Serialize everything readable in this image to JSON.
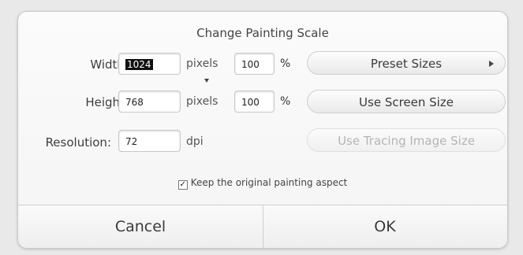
{
  "dialog": {
    "title": "Change Painting Scale",
    "width": {
      "label": "Width:",
      "value": "1024",
      "unit": "pixels",
      "percent": "100",
      "percent_sign": "%"
    },
    "height": {
      "label": "Height:",
      "value": "768",
      "unit": "pixels",
      "percent": "100",
      "percent_sign": "%"
    },
    "resolution": {
      "label": "Resolution:",
      "value": "72",
      "unit": "dpi"
    },
    "buttons": {
      "preset_sizes": "Preset Sizes",
      "use_screen_size": "Use Screen Size",
      "use_tracing_image_size": "Use Tracing Image Size"
    },
    "keep_aspect": {
      "label": "Keep the original painting aspect",
      "checked": true
    },
    "footer": {
      "cancel": "Cancel",
      "ok": "OK"
    }
  }
}
